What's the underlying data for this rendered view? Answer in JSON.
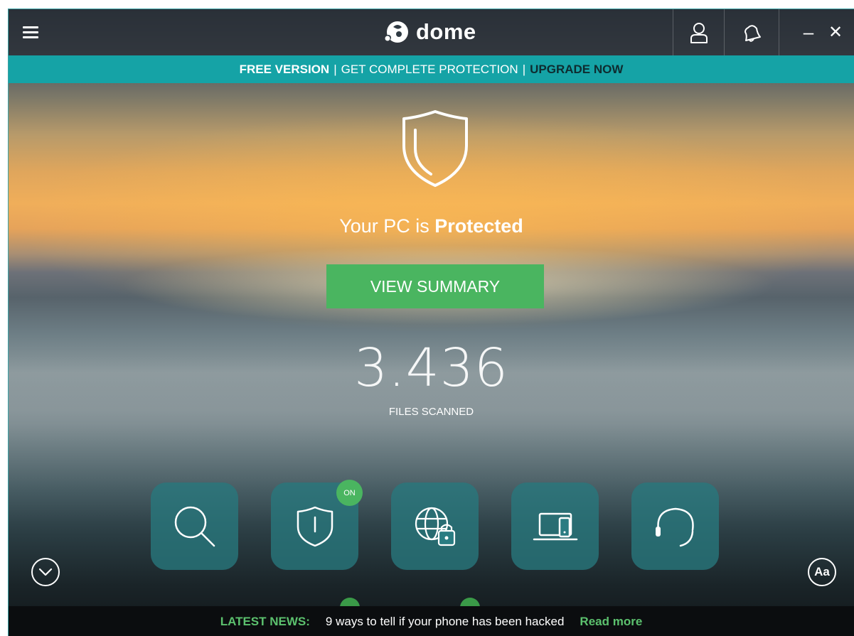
{
  "app": {
    "name": "dome",
    "logo_small_text": "Panda"
  },
  "titlebar": {
    "menu_icon": "hamburger-icon",
    "account_icon": "user-icon",
    "notifications_icon": "bell-icon",
    "minimize_label": "–",
    "close_label": "✕"
  },
  "banner": {
    "free_version": "FREE VERSION",
    "separator": "|",
    "get_protection": "GET COMPLETE PROTECTION",
    "upgrade": "UPGRADE NOW"
  },
  "status": {
    "prefix": "Your PC is ",
    "state": "Protected"
  },
  "summary_button": "VIEW SUMMARY",
  "scan": {
    "count": "3.436",
    "label": "FILES SCANNED"
  },
  "tiles": [
    {
      "icon": "search-icon"
    },
    {
      "icon": "shield-icon",
      "badge": "ON"
    },
    {
      "icon": "globe-lock-icon"
    },
    {
      "icon": "devices-icon"
    },
    {
      "icon": "headset-icon"
    }
  ],
  "expand_icon": "chevron-down-icon",
  "font_size_button": "Aa",
  "news": {
    "label": "LATEST NEWS:",
    "headline": "9 ways to tell if your phone has been hacked",
    "link": "Read more"
  },
  "colors": {
    "accent_teal": "#15a3a6",
    "accent_green": "#4ab560",
    "news_green": "#5cc16e",
    "upgrade_text": "#0e2c30"
  }
}
